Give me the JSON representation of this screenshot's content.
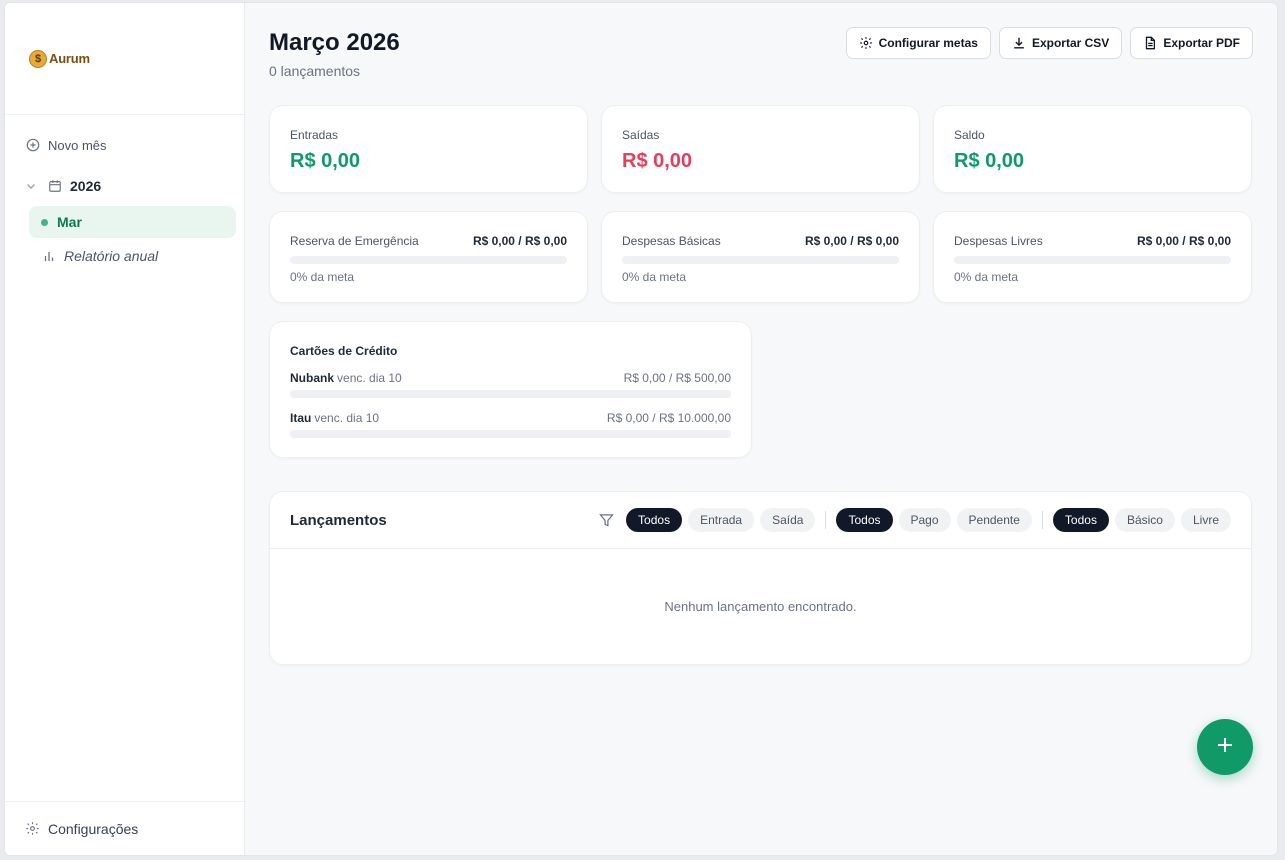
{
  "app": {
    "name": "Aurum",
    "logo_symbol": "$"
  },
  "sidebar": {
    "new_month": "Novo mês",
    "year": "2026",
    "month": "Mar",
    "annual_report": "Relatório anual",
    "settings": "Configurações"
  },
  "header": {
    "title": "Março 2026",
    "subtitle": "0 lançamentos",
    "buttons": {
      "goals": "Configurar metas",
      "csv": "Exportar CSV",
      "pdf": "Exportar PDF"
    }
  },
  "summary": {
    "income": {
      "label": "Entradas",
      "value": "R$ 0,00"
    },
    "expenses": {
      "label": "Saídas",
      "value": "R$ 0,00"
    },
    "balance": {
      "label": "Saldo",
      "value": "R$ 0,00"
    }
  },
  "goals": [
    {
      "name": "Reserva de Emergência",
      "value": "R$ 0,00 / R$ 0,00",
      "percent_text": "0% da meta",
      "progress": 0
    },
    {
      "name": "Despesas Básicas",
      "value": "R$ 0,00 / R$ 0,00",
      "percent_text": "0% da meta",
      "progress": 0
    },
    {
      "name": "Despesas Livres",
      "value": "R$ 0,00 / R$ 0,00",
      "percent_text": "0% da meta",
      "progress": 0
    }
  ],
  "credit_cards": {
    "title": "Cartões de Crédito",
    "cards": [
      {
        "name": "Nubank",
        "due": "venc. dia 10",
        "amount": "R$ 0,00 / R$ 500,00",
        "progress": 0
      },
      {
        "name": "Itau",
        "due": "venc. dia 10",
        "amount": "R$ 0,00 / R$ 10.000,00",
        "progress": 0
      }
    ]
  },
  "entries": {
    "title": "Lançamentos",
    "filter_type": [
      "Todos",
      "Entrada",
      "Saída"
    ],
    "filter_status": [
      "Todos",
      "Pago",
      "Pendente"
    ],
    "filter_category": [
      "Todos",
      "Básico",
      "Livre"
    ],
    "selected": {
      "type": "Todos",
      "status": "Todos",
      "category": "Todos"
    },
    "empty": "Nenhum lançamento encontrado."
  },
  "icons": {
    "new_month": "plus-circle-icon",
    "year": "calendar-icon",
    "report": "bar-chart-icon",
    "settings": "gear-icon",
    "goals": "gear-icon",
    "csv": "download-icon",
    "pdf": "file-text-icon",
    "filter": "filter-icon",
    "fab": "plus-icon"
  },
  "colors": {
    "positive": "#0f9a68",
    "negative": "#e53e5a",
    "accent_bg": "#e8f6ef",
    "active_pill": "#111827"
  }
}
